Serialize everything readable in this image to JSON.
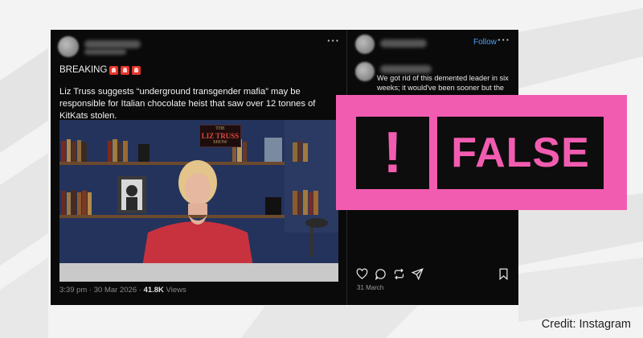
{
  "post": {
    "breaking_label": "BREAKING",
    "headline": "Liz Truss suggests “underground transgender mafia” may be responsible for Italian chocolate heist that saw over 12 tonnes of KitKats stolen.",
    "video": {
      "show_logo_line1": "THE",
      "show_logo_line2": "LIZ TRUSS",
      "show_logo_line3": "SHOW"
    },
    "meta": {
      "time_date": "3:39 pm · 30 Mar 2026 · ",
      "views_count": "41.8K",
      "views_label": " Views"
    },
    "more_icon": "more-horizontal-icon"
  },
  "sidebar": {
    "follow_label": "Follow",
    "comment_text": "We got rid of this demented leader in six weeks; it would've been sooner but the",
    "date": "31 March",
    "actions": [
      "heart-icon",
      "comment-icon",
      "repost-icon",
      "share-icon",
      "bookmark-icon"
    ]
  },
  "badge": {
    "exclamation": "!",
    "verdict": "FALSE",
    "color": "#f25cb0"
  },
  "credit": "Credit: Instagram"
}
